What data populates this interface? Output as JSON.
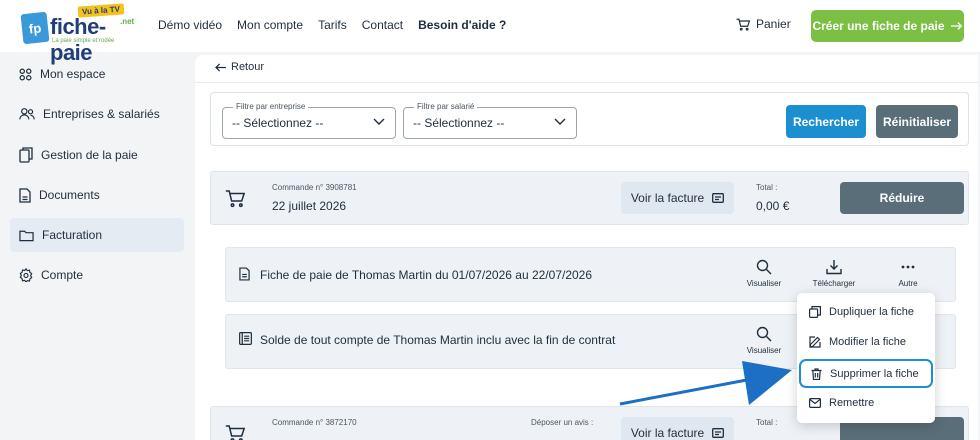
{
  "header": {
    "logo": {
      "letters": "fp",
      "brand": "fiche-paie",
      "tld": ".net",
      "tv_badge": "Vu à la TV",
      "tagline": "La paie simple et rodée"
    },
    "nav": [
      "Démo vidéo",
      "Mon compte",
      "Tarifs",
      "Contact"
    ],
    "help": "Besoin d'aide ?",
    "cart": "Panier",
    "cta": "Créer une fiche de paie",
    "cta_icon": "arrow-right-icon"
  },
  "sidebar": {
    "items": [
      {
        "label": "Mon espace",
        "icon": "dashboard-icon",
        "active": false
      },
      {
        "label": "Entreprises & salariés",
        "icon": "users-icon",
        "active": false
      },
      {
        "label": "Gestion de la paie",
        "icon": "documents-icon",
        "active": false
      },
      {
        "label": "Documents",
        "icon": "file-icon",
        "active": false
      },
      {
        "label": "Facturation",
        "icon": "folder-icon",
        "active": true
      },
      {
        "label": "Compte",
        "icon": "gear-icon",
        "active": false
      }
    ]
  },
  "main": {
    "back": "Retour",
    "filters": {
      "company_label": "Filtre par entreprise",
      "company_value": "-- Sélectionnez --",
      "employee_label": "Filtre par salarié",
      "employee_value": "-- Sélectionnez --",
      "search": "Rechercher",
      "reset": "Réinitialiser"
    },
    "order1": {
      "number": "Commande n° 3908781",
      "date": "22 juillet 2026",
      "invoice": "Voir la facture",
      "total_label": "Total :",
      "total_value": "0,00 €",
      "reduce": "Réduire"
    },
    "docs": [
      {
        "title": "Fiche de paie de Thomas Martin du 01/07/2026 au 22/07/2026"
      },
      {
        "title": "Solde de tout compte de Thomas Martin inclu avec la fin de contrat"
      }
    ],
    "actions": {
      "view": "Visualiser",
      "download": "Télécharger",
      "more": "Autre"
    },
    "order2": {
      "number": "Commande n° 3872170",
      "depose": "Déposer un avis :",
      "invoice": "Voir la facture",
      "total_label": "Total :"
    }
  },
  "menu": {
    "items": [
      {
        "label": "Dupliquer la fiche",
        "icon": "copy-icon"
      },
      {
        "label": "Modifier la fiche",
        "icon": "edit-icon"
      },
      {
        "label": "Supprimer la fiche",
        "icon": "trash-icon",
        "highlighted": true
      },
      {
        "label": "Remettre",
        "icon": "mail-icon"
      }
    ]
  },
  "colors": {
    "primary_blue": "#1b8fd0",
    "cta_green": "#7bbf44",
    "slate_button": "#5a6e7a",
    "highlight": "#1b8fd0"
  }
}
